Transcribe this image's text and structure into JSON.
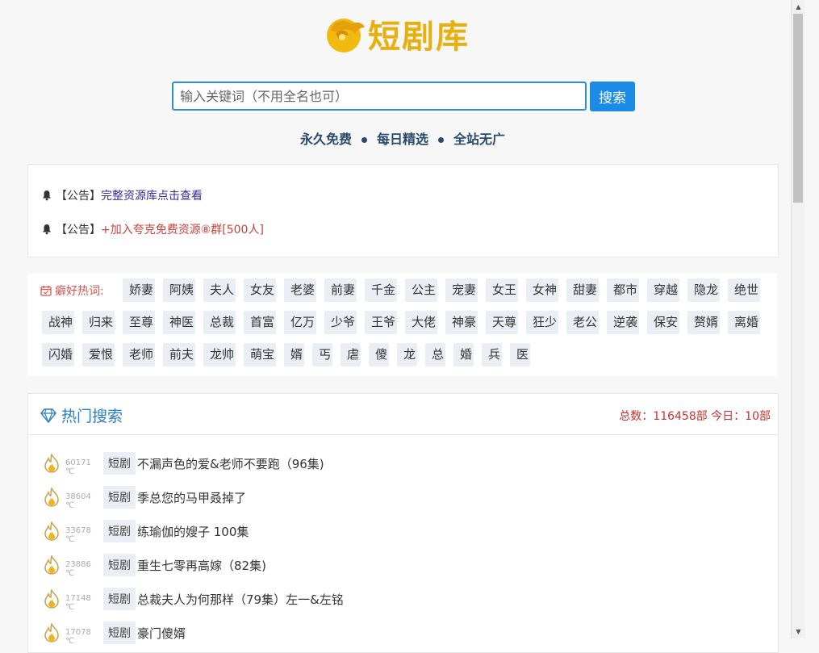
{
  "header": {
    "logo_text": "短剧库"
  },
  "search": {
    "placeholder": "输入关键词（不用全名也可）",
    "button_label": "搜索"
  },
  "slogans": [
    "永久免费",
    "每日精选",
    "全站无广"
  ],
  "notices": [
    {
      "prefix": "【公告】",
      "text": "完整资源库点击查看",
      "color": "#3a2a9a"
    },
    {
      "prefix": "【公告】",
      "text": "+加入夸克免费资源⑧群[500人]",
      "color": "#c8423a"
    }
  ],
  "hot_words": {
    "title": "癖好热词:",
    "rows": [
      [
        "娇妻",
        "阿姨",
        "夫人",
        "女友",
        "老婆",
        "前妻",
        "千金",
        "公主",
        "宠妻",
        "女王",
        "女神",
        "甜妻",
        "都市",
        "穿越",
        "隐龙",
        "绝世"
      ],
      [
        "战神",
        "归来",
        "至尊",
        "神医",
        "总裁",
        "首富",
        "亿万",
        "少爷",
        "王爷",
        "大佬",
        "神豪",
        "天尊",
        "狂少",
        "老公",
        "逆袭",
        "保安",
        "赘婿",
        "离婚"
      ],
      [
        "闪婚",
        "爱恨",
        "老师",
        "前夫",
        "龙帅",
        "萌宝",
        "婿",
        "丐",
        "虐",
        "傻",
        "龙",
        "总",
        "婚",
        "兵",
        "医"
      ]
    ]
  },
  "hot_search": {
    "title": "热门搜索",
    "stats": "总数：116458部 今日：10部",
    "items": [
      {
        "heat": "60171 ℃",
        "kind": "短剧",
        "title": "不漏声色的爱&老师不要跑（96集)"
      },
      {
        "heat": "38604 ℃",
        "kind": "短剧",
        "title": "季总您的马甲叒掉了"
      },
      {
        "heat": "33678 ℃",
        "kind": "短剧",
        "title": "练瑜伽的嫂子 100集"
      },
      {
        "heat": "23886 ℃",
        "kind": "短剧",
        "title": "重生七零再高嫁（82集)"
      },
      {
        "heat": "17148 ℃",
        "kind": "短剧",
        "title": "总裁夫人为何那样（79集）左一&左铭"
      },
      {
        "heat": "17078 ℃",
        "kind": "短剧",
        "title": "豪门傻婿"
      }
    ]
  },
  "colors": {
    "accent": "#1a8ce8",
    "logo": "#e8b00f",
    "alert": "#c9302c"
  }
}
